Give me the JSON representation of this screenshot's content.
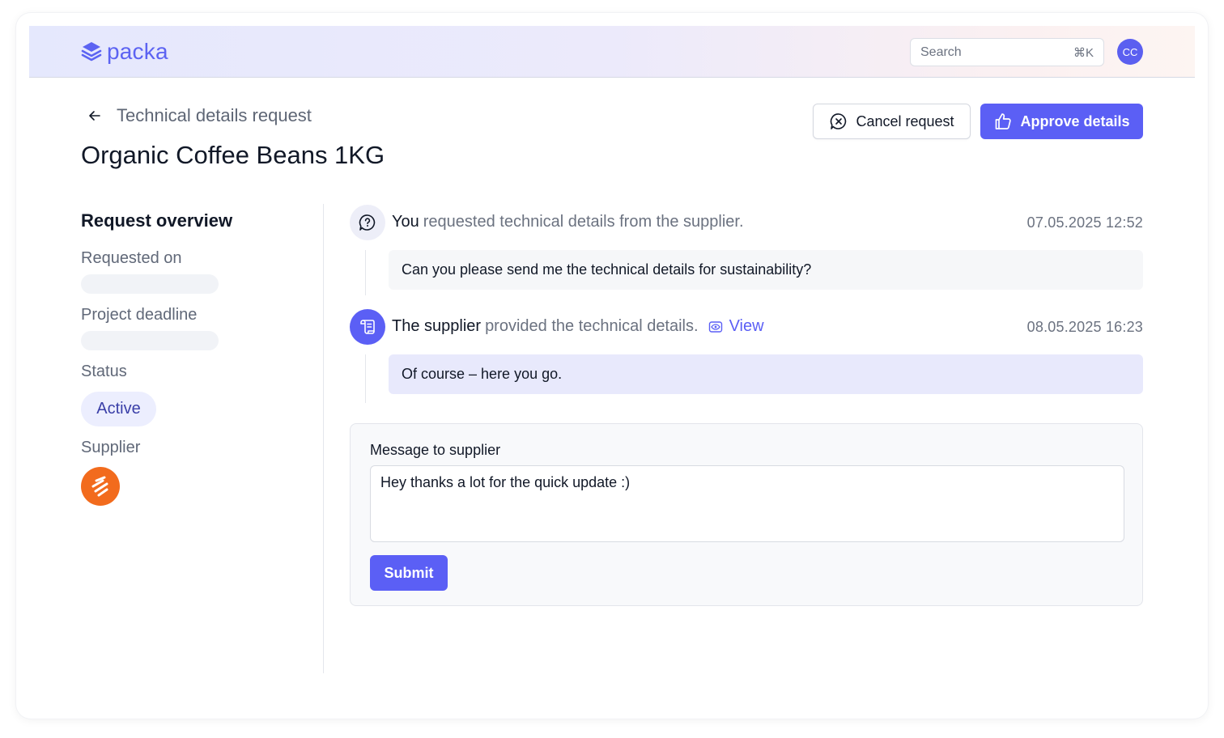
{
  "colors": {
    "accent": "#5b5ff5",
    "supplier_brand": "#f26b1d",
    "status_badge_bg": "#eceefe",
    "status_badge_text": "#3a3fa8"
  },
  "header": {
    "logo_icon": "stacked-layers-icon",
    "brand": "packa",
    "search": {
      "placeholder": "Search",
      "shortcut": "⌘K"
    },
    "avatar_initials": "CC"
  },
  "page": {
    "breadcrumb": "Technical details request",
    "title": "Organic Coffee Beans 1KG",
    "actions": {
      "cancel": {
        "label": "Cancel request",
        "icon": "chat-cancel-icon"
      },
      "approve": {
        "label": "Approve details",
        "icon": "thumbs-up-icon"
      }
    }
  },
  "overview": {
    "title": "Request overview",
    "requested_on_label": "Requested on",
    "project_deadline_label": "Project deadline",
    "status_label": "Status",
    "status_value": "Active",
    "supplier_label": "Supplier",
    "supplier_logo_icon": "supplier-logo-icon"
  },
  "timeline": [
    {
      "icon": "chat-question-icon",
      "actor": "You",
      "action": "requested technical details from the supplier.",
      "timestamp": "07.05.2025 12:52",
      "message": "Can you please send me the technical details for sustainability?"
    },
    {
      "icon": "scroll-document-icon",
      "actor": "The supplier",
      "action": "provided the technical details.",
      "link_label": "View",
      "link_icon": "eye-icon",
      "timestamp": "08.05.2025 16:23",
      "message": "Of course – here you go."
    }
  ],
  "composer": {
    "label": "Message to supplier",
    "value": "Hey thanks a lot for the quick update :)",
    "submit_label": "Submit"
  }
}
